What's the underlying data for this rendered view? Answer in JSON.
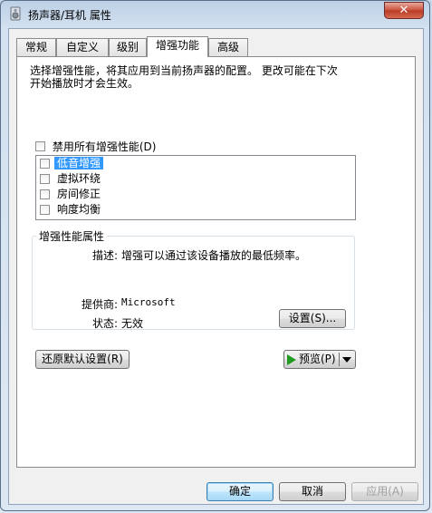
{
  "window": {
    "title": "扬声器/耳机 属性",
    "close_label": "✕"
  },
  "tabs": [
    {
      "label": "常规"
    },
    {
      "label": "自定义"
    },
    {
      "label": "级别"
    },
    {
      "label": "增强功能"
    },
    {
      "label": "高级"
    }
  ],
  "enhancements": {
    "description_line1": "选择增强性能，将其应用到当前扬声器的配置。  更改可能在下次",
    "description_line2": "开始播放时才会生效。",
    "disable_all_label": "禁用所有增强性能(D)",
    "items": [
      {
        "label": "低音增强",
        "checked": false,
        "selected": true
      },
      {
        "label": "虚拟环绕",
        "checked": false,
        "selected": false
      },
      {
        "label": "房间修正",
        "checked": false,
        "selected": false
      },
      {
        "label": "响度均衡",
        "checked": false,
        "selected": false
      }
    ]
  },
  "properties": {
    "group_title": "增强性能属性",
    "description_label": "描述:",
    "description_value": "增强可以通过该设备播放的最低频率。",
    "provider_label": "提供商:",
    "provider_value": "Microsoft",
    "status_label": "状态:",
    "status_value": "无效",
    "settings_button": "设置(S)..."
  },
  "actions": {
    "restore_defaults": "还原默认设置(R)",
    "preview": "预览(P)"
  },
  "footer": {
    "ok": "确定",
    "cancel": "取消",
    "apply": "应用(A)"
  },
  "colors": {
    "selection": "#3399ff",
    "play_icon": "#1f9b1f"
  }
}
